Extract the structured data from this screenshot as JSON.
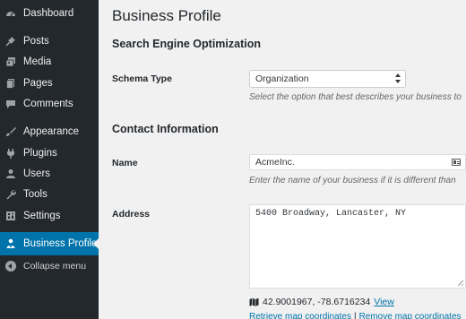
{
  "sidebar": {
    "items": [
      {
        "label": "Dashboard",
        "icon": "dashboard-icon"
      },
      {
        "label": "Posts",
        "icon": "pin-icon"
      },
      {
        "label": "Media",
        "icon": "media-icon"
      },
      {
        "label": "Pages",
        "icon": "pages-icon"
      },
      {
        "label": "Comments",
        "icon": "comment-icon"
      },
      {
        "label": "Appearance",
        "icon": "brush-icon"
      },
      {
        "label": "Plugins",
        "icon": "plug-icon"
      },
      {
        "label": "Users",
        "icon": "user-icon"
      },
      {
        "label": "Tools",
        "icon": "wrench-icon"
      },
      {
        "label": "Settings",
        "icon": "settings-icon"
      }
    ],
    "active": {
      "label": "Business Profile",
      "icon": "business-profile-icon"
    },
    "collapse": {
      "label": "Collapse menu",
      "icon": "collapse-icon"
    }
  },
  "main": {
    "page_title": "Business Profile",
    "seo_section": "Search Engine Optimization",
    "schema_label": "Schema Type",
    "schema_value": "Organization",
    "schema_desc": "Select the option that best describes your business to",
    "contact_section": "Contact Information",
    "name_label": "Name",
    "name_value": "AcmeInc.",
    "name_desc": "Enter the name of your business if it is different than",
    "address_label": "Address",
    "address_value": "5400 Broadway, Lancaster, NY",
    "coords_text": "42.9001967, -78.6716234",
    "view_link": "View",
    "retrieve_link": "Retrieve map coordinates",
    "separator": "|",
    "remove_link": "Remove map coordinates"
  },
  "colors": {
    "sidebar_bg": "#23282d",
    "active_bg": "#0073aa",
    "link": "#0073aa",
    "page_bg": "#f1f1f1"
  }
}
